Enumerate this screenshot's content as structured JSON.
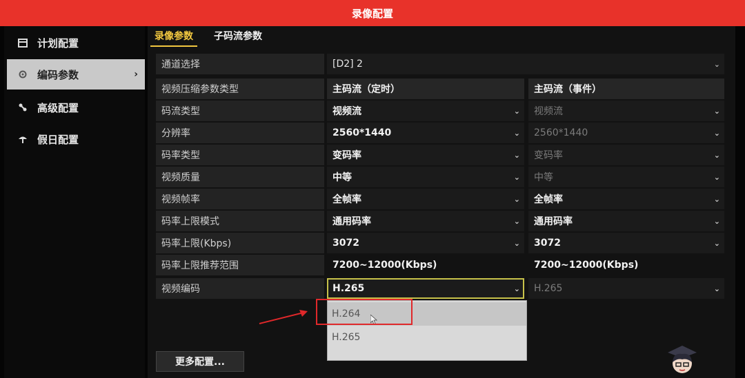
{
  "window": {
    "title": "录像配置"
  },
  "sidebar": {
    "items": [
      {
        "label": "计划配置",
        "icon": "calendar-icon"
      },
      {
        "label": "编码参数",
        "icon": "gear-icon",
        "active": true
      },
      {
        "label": "高级配置",
        "icon": "tools-icon"
      },
      {
        "label": "假日配置",
        "icon": "umbrella-icon"
      }
    ]
  },
  "tabs": [
    {
      "label": "录像参数",
      "active": true
    },
    {
      "label": "子码流参数",
      "active": false
    }
  ],
  "form": {
    "channel": {
      "label": "通道选择",
      "value": "[D2] 2"
    },
    "header": {
      "label": "视频压缩参数类型",
      "col1": "主码流（定时）",
      "col2": "主码流（事件）"
    },
    "rows": [
      {
        "label": "码流类型",
        "c1": "视频流",
        "c2": "视频流"
      },
      {
        "label": "分辨率",
        "c1": "2560*1440",
        "c2": "2560*1440"
      },
      {
        "label": "码率类型",
        "c1": "变码率",
        "c2": "变码率"
      },
      {
        "label": "视频质量",
        "c1": "中等",
        "c2": "中等"
      },
      {
        "label": "视频帧率",
        "c1": "全帧率",
        "c2": "全帧率"
      },
      {
        "label": "码率上限模式",
        "c1": "通用码率",
        "c2": "通用码率"
      },
      {
        "label": "码率上限(Kbps)",
        "c1": "3072",
        "c2": "3072"
      },
      {
        "label": "码率上限推荐范围",
        "c1": "7200~12000(Kbps)",
        "c2": "7200~12000(Kbps)"
      },
      {
        "label": "视频编码",
        "c1": "H.265",
        "c2": "H.265"
      }
    ]
  },
  "dropdown": {
    "options": [
      "H.264",
      "H.265"
    ],
    "highlighted": "H.264"
  },
  "buttons": {
    "more": "更多配置..."
  },
  "colors": {
    "titlebar": "#e8322a",
    "accent": "#f2c840",
    "annotation": "#e0282a"
  }
}
